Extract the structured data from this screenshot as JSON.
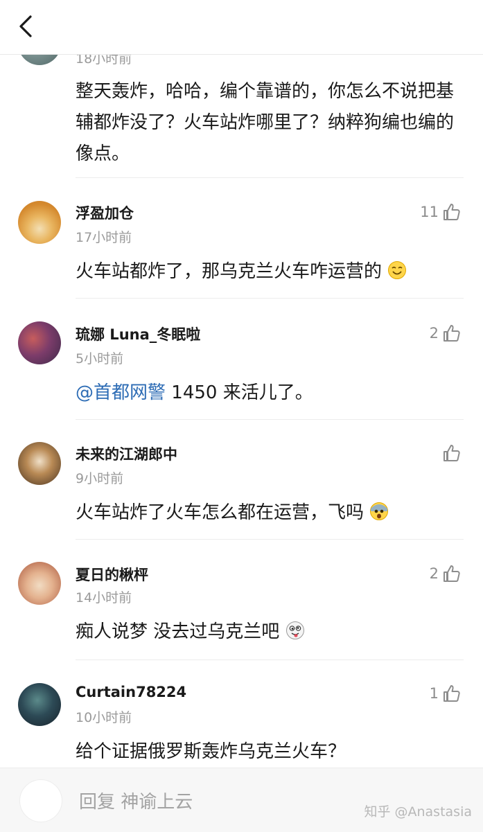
{
  "header": {
    "back_icon": "chevron-left-icon"
  },
  "comments": [
    {
      "name": "",
      "time": "18小时前",
      "text": "整天轰炸，哈哈，编个靠谱的，你怎么不说把基辅都炸没了？火车站炸哪里了？纳粹狗编也编的像点。",
      "likes": ""
    },
    {
      "name": "浮盈加仓",
      "time": "17小时前",
      "text": "火车站都炸了，那乌克兰火车咋运营的",
      "emoji": "smiling-emoji-icon",
      "likes": "11"
    },
    {
      "name": "琉娜 Luna_冬眠啦",
      "time": "5小时前",
      "mention": "@首都网警",
      "text": " 1450 来活儿了。",
      "likes": "2"
    },
    {
      "name": "未来的江湖郎中",
      "time": "9小时前",
      "text": "火车站炸了火车怎么都在运营，飞吗",
      "emoji": "scared-emoji-icon",
      "likes": ""
    },
    {
      "name": "夏日的楸枰",
      "time": "14小时前",
      "text": "痴人说梦 没去过乌克兰吧",
      "emoji": "silly-emoji-icon",
      "likes": "2"
    },
    {
      "name": "Curtain78224",
      "time": "10小时前",
      "text": "给个证据俄罗斯轰炸乌克兰火车？",
      "likes": "1"
    }
  ],
  "reply_bar": {
    "placeholder": "回复 神谕上云"
  },
  "watermark": "知乎 @Anastasia",
  "colors": {
    "mention": "#2d6cb5",
    "time": "#9a9a9a",
    "like": "#8c8c8c"
  }
}
